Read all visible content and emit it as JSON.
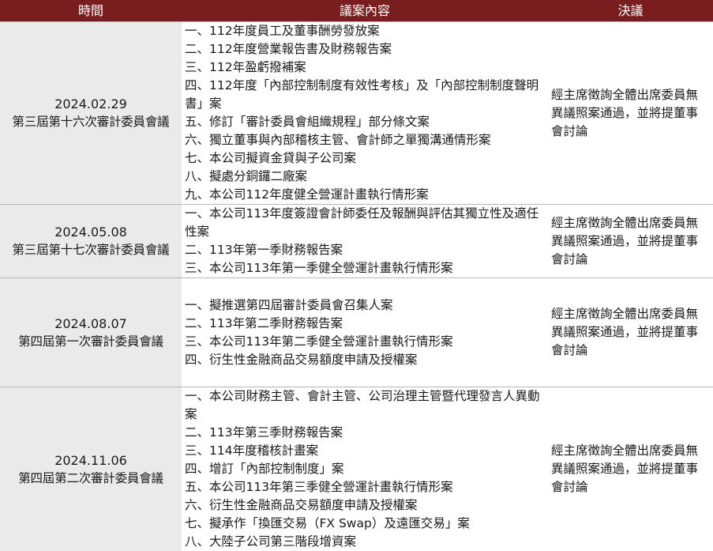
{
  "headers": {
    "time": "時間",
    "content": "議案內容",
    "resolution": "決議"
  },
  "meetings": [
    {
      "date": "2024.02.29",
      "name": "第三屆第十六次審計委員會議",
      "items": [
        "一、112年度員工及董事酬勞發放案",
        "二、112年度營業報告書及財務報告案",
        "三、112年盈虧撥補案",
        "四、112年度「內部控制制度有效性考核」及「內部控制制度聲明書」案",
        "五、修訂「審計委員會組織規程」部分條文案",
        "六、獨立董事與內部稽核主管、會計師之單獨溝通情形案",
        "七、本公司擬資金貸與子公司案",
        "八、擬處分銅鑼二廠案",
        "九、本公司112年度健全營運計畫執行情形案"
      ],
      "resolution": "經主席徵詢全體出席委員無異議照案通過，並將提董事會討論"
    },
    {
      "date": "2024.05.08",
      "name": "第三屆第十七次審計委員會議",
      "items": [
        "一、本公司113年度簽證會計師委任及報酬與評估其獨立性及適任性案",
        "二、113年第一季財務報告案",
        "三、本公司113年第一季健全營運計畫執行情形案"
      ],
      "resolution": "經主席徵詢全體出席委員無異議照案通過，並將提董事會討論"
    },
    {
      "date": "2024.08.07",
      "name": "第四屆第一次審計委員會議",
      "items": [
        "一、擬推選第四屆審計委員會召集人案",
        "二、113年第二季財務報告案",
        "三、本公司113年第二季健全營運計畫執行情形案",
        "四、衍生性金融商品交易額度申請及授權案"
      ],
      "resolution": "經主席徵詢全體出席委員無異議照案通過，並將提董事會討論"
    },
    {
      "date": "2024.11.06",
      "name": "第四屆第二次審計委員會議",
      "items": [
        "一、本公司財務主管、會計主管、公司治理主管暨代理發言人異動案",
        "二、113年第三季財務報告案",
        "三、114年度稽核計畫案",
        "四、增訂「內部控制制度」案",
        "五、本公司113年第三季健全營運計畫執行情形案",
        "六、衍生性金融商品交易額度申請及授權案",
        "七、擬承作「換匯交易（FX Swap）及遠匯交易」案",
        "八、大陸子公司第三階段增資案"
      ],
      "resolution": "經主席徵詢全體出席委員無異議照案通過，並將提董事會討論"
    }
  ]
}
